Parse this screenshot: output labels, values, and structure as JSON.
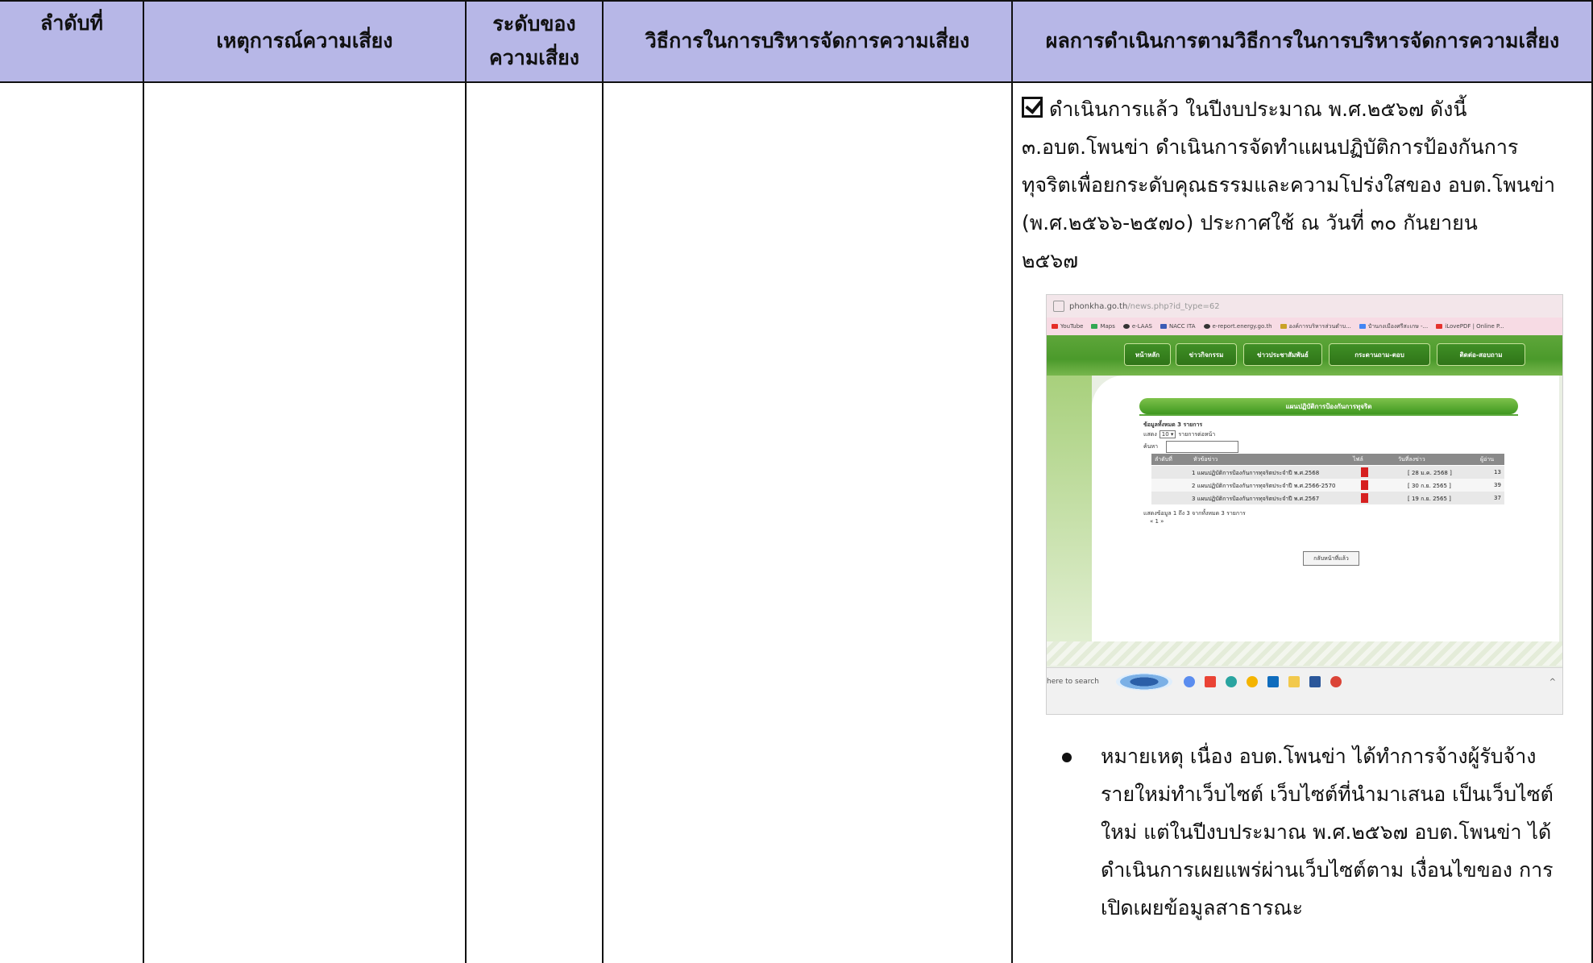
{
  "table": {
    "headers": [
      "ลำดับที่",
      "เหตุการณ์ความเสี่ยง",
      "ระดับของความเสี่ยง",
      "วิธีการในการบริหารจัดการความเสี่ยง",
      "ผลการดำเนินการตามวิธีการในการบริหารจัดการความเสี่ยง"
    ],
    "header_color": "#b7b7e7",
    "result": {
      "checkbox_state": "checked",
      "line1": "ดำเนินการแล้ว ในปีงบประมาณ พ.ศ.๒๕๖๗ ดังนี้",
      "line2": "๓.อบต.โพนข่า ดำเนินการจัดทำแผนปฏิบัติการป้องกันการ",
      "line3": "ทุจริตเพื่อยกระดับคุณธรรมและความโปร่งใสของ อบต.โพนข่า",
      "line4": "(พ.ศ.๒๕๖๖-๒๕๗๐) ประกาศใช้ ณ วันที่ ๓๐ กันยายน",
      "line5": "๒๕๖๗"
    },
    "note": {
      "line1": "หมายเหตุ เนื่อง อบต.โพนข่า ได้ทำการจ้างผู้รับจ้าง",
      "line2": "รายใหม่ทำเว็บไซต์ เว็บไซต์ที่นำมาเสนอ เป็นเว็บไซต์",
      "line3": "ใหม่ แต่ในปีงบประมาณ พ.ศ.๒๕๖๗ อบต.โพนข่า ได้",
      "line4": "ดำเนินการเผยแพร่ผ่านเว็บไซต์ตาม เงื่อนไขของ การ",
      "line5": "เปิดเผยข้อมูลสาธารณะ"
    }
  },
  "screenshot": {
    "url_host": "phonkha.go.th",
    "url_path": "/news.php?id_type=62",
    "bookmarks": [
      "YouTube",
      "Maps",
      "e-LAAS",
      "NACC ITA",
      "e-report.energy.go.th",
      "องค์การบริหารส่วนตำบ...",
      "ปำนกงเมืองศรีสะเกษ -...",
      "iLovePDF | Online P..."
    ],
    "nav": [
      "หน้าหลัก",
      "ข่าวกิจกรรม",
      "ข่าวประชาสัมพันธ์",
      "กระดานถาม-ตอบ",
      "ติดต่อ-สอบถาม"
    ],
    "section_title": "แผนปฏิบัติการป้องกันการทุจริต",
    "total_text": "ข้อมูลทั้งหมด 3 รายการ",
    "show_label": "แสดง",
    "show_value": "10",
    "per_page_label": "รายการต่อหน้า",
    "search_label": "ค้นหา",
    "columns": [
      "ลำดับที่",
      "หัวข้อข่าว",
      "ไฟล์",
      "วันที่ลงข่าว",
      "ผู้อ่าน"
    ],
    "rows": [
      {
        "title": "1 แผนปฏิบัติการป้องกันการทุจริตประจำปี พ.ศ.2568",
        "date": "[ 28 ม.ค. 2568 ]",
        "reads": "13"
      },
      {
        "title": "2 แผนปฏิบัติการป้องกันการทุจริตประจำปี พ.ศ.2566-2570",
        "date": "[ 30 ก.ย. 2565 ]",
        "reads": "39"
      },
      {
        "title": "3 แผนปฏิบัติการป้องกันการทุจริตประจำปี พ.ศ.2567",
        "date": "[ 19 ก.ย. 2565 ]",
        "reads": "37"
      }
    ],
    "showing_text": "แสดงข้อมูล 1 ถึง 3 จากทั้งหมด 3 รายการ",
    "pager_text": "« 1 »",
    "back_button": "กลับหน้าที่แล้ว",
    "taskbar_search": "here to search"
  }
}
